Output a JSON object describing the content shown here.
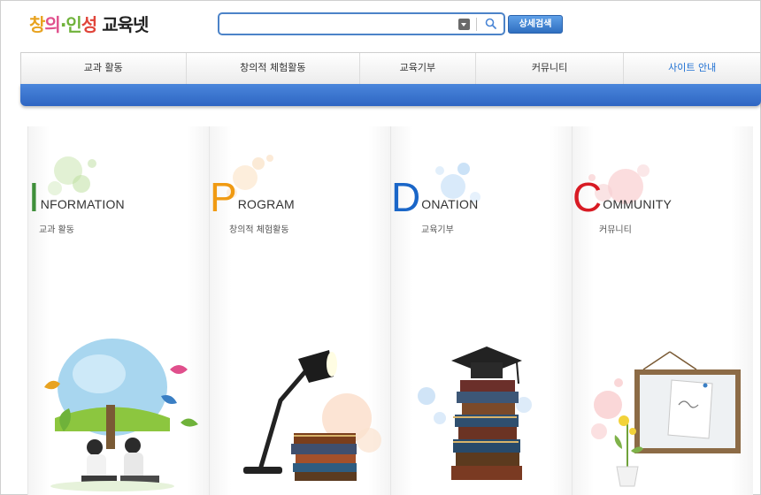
{
  "header": {
    "logo": [
      {
        "text": "창",
        "color": "#e8a321"
      },
      {
        "text": "의",
        "color": "#e04f8c"
      },
      {
        "text": "·",
        "color": "#6fb23a"
      },
      {
        "text": "인",
        "color": "#6fb23a"
      },
      {
        "text": "성",
        "color": "#e0453a"
      },
      {
        "text": " 교육넷",
        "color": "#222222"
      }
    ],
    "search": {
      "value": "",
      "placeholder": ""
    },
    "detail_search": "상세검색"
  },
  "nav": {
    "items": [
      {
        "label": "교과 활동"
      },
      {
        "label": "창의적 체험활동"
      },
      {
        "label": "교육기부"
      },
      {
        "label": "커뮤니티"
      },
      {
        "label": "사이트 안내"
      }
    ],
    "active_index": 4,
    "bar_color": "#3574cf"
  },
  "columns": [
    {
      "letter": "I",
      "rest": "NFORMATION",
      "sub": "교과 활동",
      "accent": "#3f8f3a",
      "icon": "globe-tree-icon"
    },
    {
      "letter": "P",
      "rest": "ROGRAM",
      "sub": "창의적 체험활동",
      "accent": "#f09a12",
      "icon": "desk-lamp-books-icon"
    },
    {
      "letter": "D",
      "rest": "ONATION",
      "sub": "교육기부",
      "accent": "#1a66c8",
      "icon": "graduation-books-icon"
    },
    {
      "letter": "C",
      "rest": "OMMUNITY",
      "sub": "커뮤니티",
      "accent": "#d81b24",
      "icon": "bulletin-board-icon"
    }
  ]
}
